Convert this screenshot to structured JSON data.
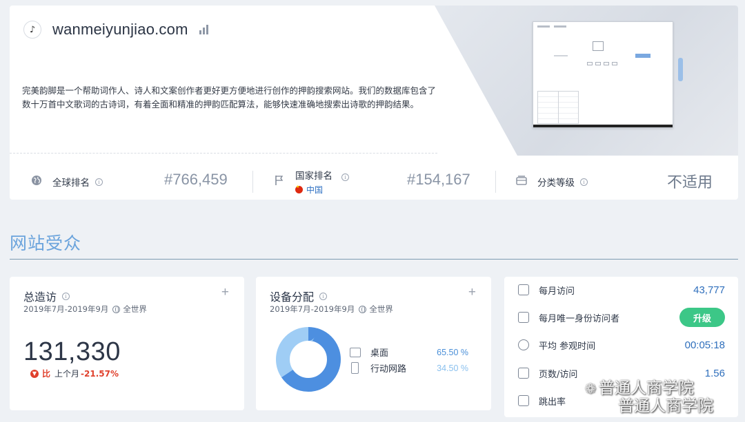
{
  "header": {
    "domain": "wanmeiyunjiao.com",
    "logo_glyph": "♪",
    "description": "完美韵脚是一个帮助词作人、诗人和文案创作者更好更方便地进行创作的押韵搜索网站。我们的数据库包含了数十万首中文歌词的古诗词，有着全面和精准的押韵匹配算法，能够快速准确地搜索出诗歌的押韵结果。"
  },
  "rankings": {
    "global": {
      "label": "全球排名",
      "value": "#766,459",
      "icon": "globe-icon"
    },
    "country": {
      "label": "国家排名",
      "country": "中国",
      "value": "#154,167",
      "icon": "flag-icon"
    },
    "category": {
      "label": "分类等级",
      "value": "不适用",
      "icon": "category-icon"
    }
  },
  "audience": {
    "title": "网站受众"
  },
  "total_visits": {
    "title": "总造访",
    "period": "2019年7月-2019年9月",
    "scope": "全世界",
    "value": "131,330",
    "change_label": "比",
    "change_prefix": "上个月",
    "change_value": "-21.57%"
  },
  "device": {
    "title": "设备分配",
    "period": "2019年7月-2019年9月",
    "scope": "全世界",
    "items": [
      {
        "label": "桌面",
        "value": "65.50 %",
        "pct": 65.5,
        "color": "#4d8fe0",
        "icon": "desktop-icon"
      },
      {
        "label": "行动网路",
        "value": "34.50 %",
        "pct": 34.5,
        "color": "#9fcdf5",
        "icon": "mobile-icon"
      }
    ]
  },
  "stats": {
    "monthly_visits": {
      "label": "每月访问",
      "value": "43,777",
      "icon": "calendar-icon"
    },
    "unique_visitors": {
      "label": "每月唯一身份访问者",
      "button": "升级",
      "icon": "id-card-icon"
    },
    "avg_duration": {
      "label": "平均 参观时间",
      "value": "00:05:18",
      "icon": "stopwatch-icon"
    },
    "pages_per_visit": {
      "label": "页数/访问",
      "value": "1.56",
      "icon": "pages-icon"
    },
    "bounce_rate": {
      "label": "跳出率",
      "icon": "bounce-icon"
    }
  },
  "plus_glyph": "+",
  "info_glyph": "i",
  "watermark": {
    "line1": "普通人商学院",
    "line2": "普通人商学院"
  },
  "colors": {
    "accent": "#6aa3dc",
    "link": "#2d6fc2",
    "negative": "#e0402c",
    "upgrade": "#3cc787"
  }
}
